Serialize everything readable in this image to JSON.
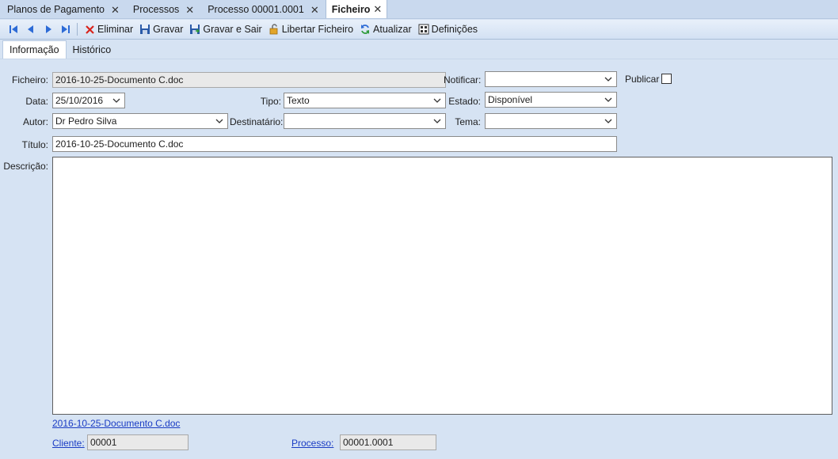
{
  "doc_tabs": [
    {
      "label": "Planos de Pagamento"
    },
    {
      "label": "Processos"
    },
    {
      "label": "Processo 00001.0001"
    },
    {
      "label": "Ficheiro",
      "active": true
    }
  ],
  "toolbar": {
    "delete_label": "Eliminar",
    "save_label": "Gravar",
    "save_exit_label": "Gravar e Sair",
    "release_label": "Libertar Ficheiro",
    "refresh_label": "Atualizar",
    "settings_label": "Definições"
  },
  "sub_tabs": {
    "info": "Informação",
    "history": "Histórico"
  },
  "form": {
    "ficheiro_label": "Ficheiro:",
    "ficheiro_value": "2016-10-25-Documento C.doc",
    "notificar_label": "Notificar:",
    "notificar_value": "",
    "publicar_label": "Publicar",
    "data_label": "Data:",
    "data_value": "25/10/2016",
    "tipo_label": "Tipo:",
    "tipo_value": "Texto",
    "estado_label": "Estado:",
    "estado_value": "Disponível",
    "autor_label": "Autor:",
    "autor_value": "Dr Pedro Silva",
    "destinatario_label": "Destinatário:",
    "destinatario_value": "",
    "tema_label": "Tema:",
    "tema_value": "",
    "titulo_label": "Título:",
    "titulo_value": "2016-10-25-Documento C.doc",
    "descricao_label": "Descrição:",
    "descricao_value": ""
  },
  "footer": {
    "file_link": "2016-10-25-Documento C.doc",
    "cliente_label": "Cliente:",
    "cliente_value": "00001",
    "processo_label": "Processo:",
    "processo_value": "00001.0001"
  },
  "colors": {
    "background": "#d6e3f3",
    "link": "#1a3cc4",
    "delete_icon": "#d9241c",
    "nav_icon": "#2d6bd6"
  }
}
